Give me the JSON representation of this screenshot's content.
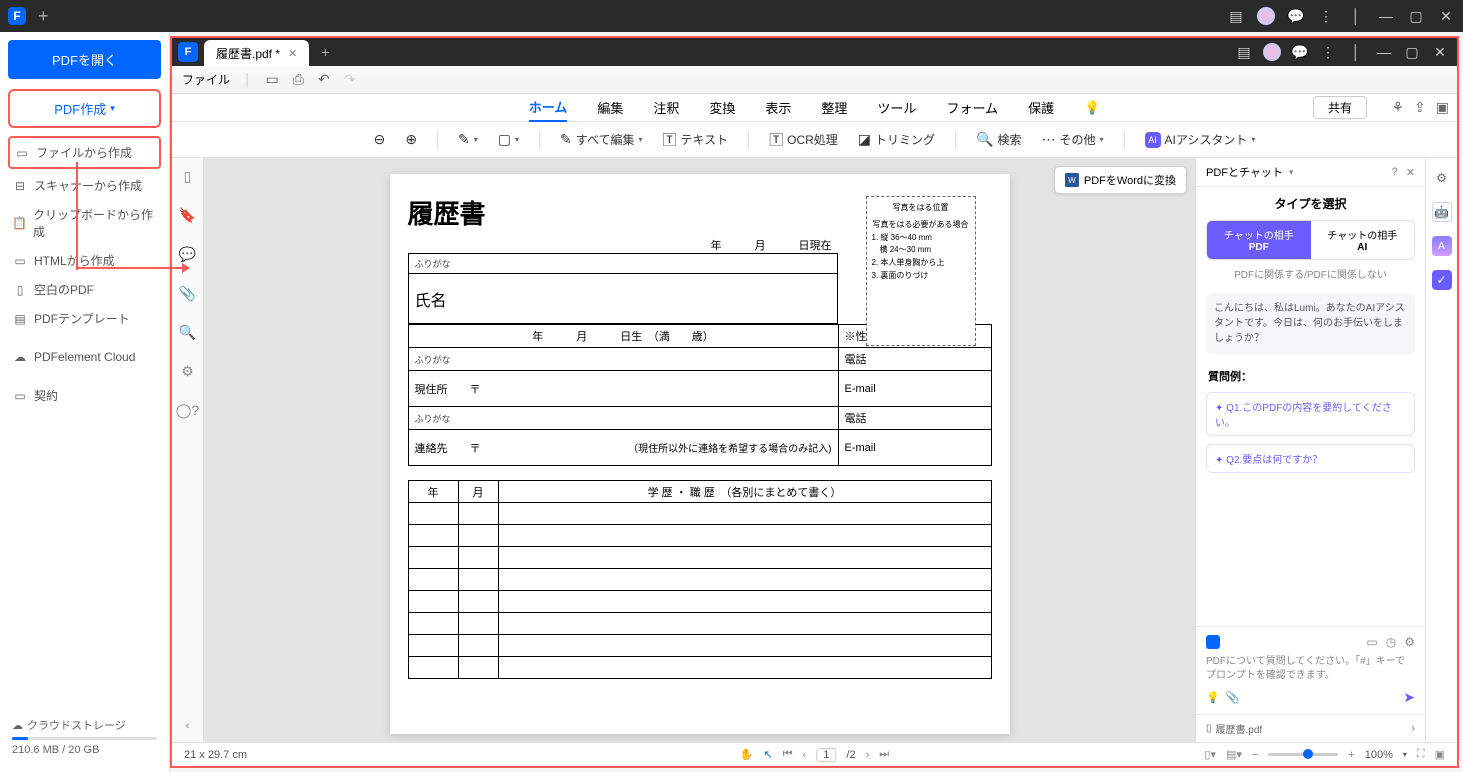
{
  "titlebar": {
    "logo": "F"
  },
  "sidebar": {
    "open": "PDFを開く",
    "create": "PDF作成",
    "items": [
      "ファイルから作成",
      "スキャナーから作成",
      "クリップボードから作成",
      "HTMLから作成",
      "空白のPDF",
      "PDFテンプレート"
    ],
    "cloud": "PDFelement Cloud",
    "contract": "契約",
    "storage_label": "クラウドストレージ",
    "storage_value": "210.6 MB / 20 GB"
  },
  "editor": {
    "tab": "履歴書.pdf *",
    "file_label": "ファイル",
    "menu": [
      "ホーム",
      "編集",
      "注釈",
      "変換",
      "表示",
      "整理",
      "ツール",
      "フォーム",
      "保護"
    ],
    "share": "共有",
    "tools": {
      "edit_all": "すべて編集",
      "text": "テキスト",
      "ocr": "OCR処理",
      "trim": "トリミング",
      "search": "検索",
      "other": "その他",
      "ai_badge": "AI",
      "ai": "AIアシスタント"
    },
    "word_btn": "PDFをWordに変換"
  },
  "doc": {
    "title": "履歴書",
    "date": "年　　　月　　　日現在",
    "furigana": "ふりがな",
    "name_label": "氏名",
    "birth": "年　　　月　　　日生　（満　　歳）",
    "sex": "※性別",
    "tel": "電話",
    "email": "E-mail",
    "addr": "現住所　　〒",
    "contact": "連絡先　　〒",
    "contact_note": "（現住所以外に連絡を希望する場合のみ記入)",
    "edu_header": "学 歴 ・ 職 歴　（各別にまとめて書く）",
    "year": "年",
    "month": "月",
    "photo": {
      "t1": "写真をはる位置",
      "t2": "写真をはる必要がある場合",
      "l1": "1. 縦 36～40 mm",
      "l2": "　横 24～30 mm",
      "l3": "2. 本人単身胸から上",
      "l4": "3. 裏面のりづけ"
    }
  },
  "chat": {
    "title": "PDFとチャット",
    "type": "タイプを選択",
    "tab1_a": "チャットの相手",
    "tab1_b": "PDF",
    "tab2_a": "チャットの相手",
    "tab2_b": "AI",
    "sub": "PDFに関係する/PDFに関係しない",
    "greet": "こんにちは、私はLumi。あなたのAIアシスタントです。今日は、何のお手伝いをしましょうか？",
    "ex_title": "質問例：",
    "ex1": "Q1.このPDFの内容を要約してください。",
    "ex2": "Q2.要点は何ですか？",
    "hint": "PDFについて質問してください。「#」キーでプロンプトを確認できます。",
    "file": "履歴書.pdf"
  },
  "status": {
    "size": "21 x 29.7 cm",
    "page": "1",
    "total": "/2",
    "zoom": "100%"
  }
}
